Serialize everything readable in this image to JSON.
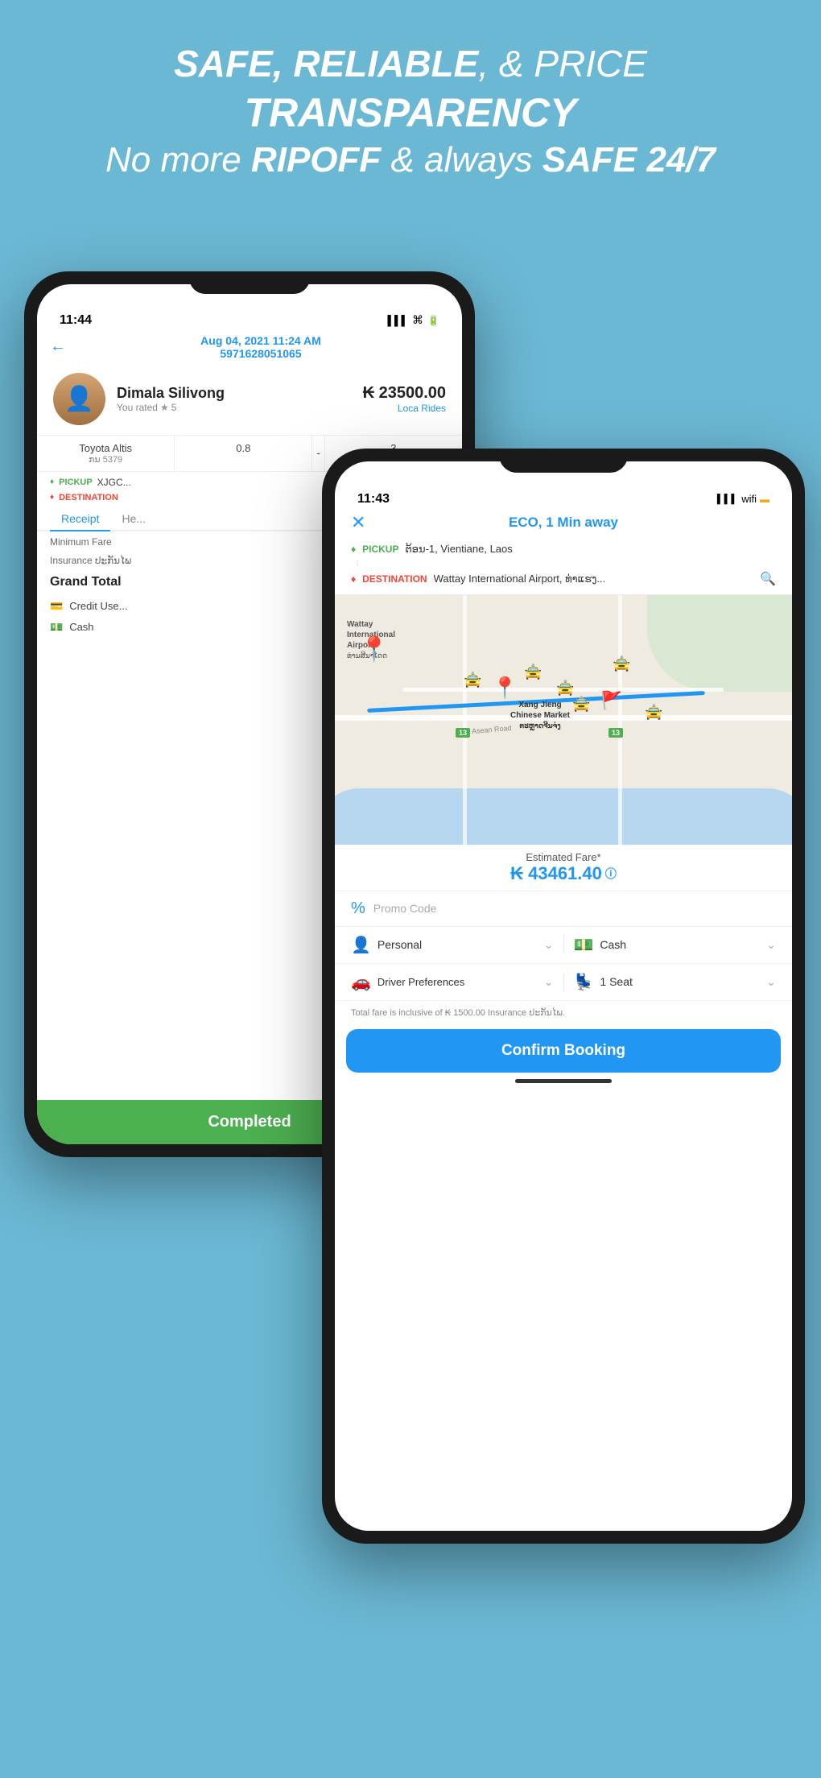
{
  "headline": {
    "line1_prefix": "SAFE, ",
    "line1_bold1": "RELIABLE",
    "line1_suffix": ", & PRICE",
    "line2_bold": "TRANSPARENCY",
    "line3_prefix": "No more ",
    "line3_bold1": "RIPOFF",
    "line3_suffix": " & always ",
    "line3_bold2": "SAFE 24/7"
  },
  "phone_back": {
    "status_time": "11:44",
    "header_date": "Aug 04, 2021 11:24 AM",
    "header_booking_id": "5971628051065",
    "driver_name": "Dimala  Silivong",
    "driver_rating_text": "You rated",
    "driver_rating_stars": "★",
    "driver_rating_value": "5",
    "fare_amount": "₭ 23500.00",
    "fare_service": "Loca Rides",
    "car_model": "Toyota Altis",
    "car_distance": "0.8",
    "car_separator": "-",
    "car_time": "3",
    "car_plate": "ກນ 5379",
    "pickup_label": "PICKUP",
    "pickup_text": "XJGC...",
    "dest_label": "DESTINATION",
    "tab_receipt": "Receipt",
    "tab_help": "He...",
    "min_fare_label": "Minimum Fare",
    "insurance_label": "Insurance ປະກັນໄພ",
    "grand_total_label": "Grand Total",
    "payment_credit": "Credit Use...",
    "payment_cash": "Cash",
    "completed_label": "Completed"
  },
  "phone_front": {
    "status_time": "11:43",
    "header_title": "ECO, 1 Min away",
    "close_btn": "✕",
    "pickup_label": "PICKUP",
    "pickup_addr": "ຕ້ອນ-1, Vientiane, Laos",
    "dest_label": "DESTINATION",
    "dest_addr": "Wattay International Airport, ທ່າແຮງ...",
    "map_airport_label": "Wattay\nInternational\nAirport",
    "map_market_label": "Xang Jieng\nChinese Market\nຕະຫຼາດຈີນຈ່ງ",
    "estimated_fare_label": "Estimated Fare*",
    "estimated_fare": "₭ 43461.40",
    "promo_placeholder": "Promo Code",
    "option1_label": "Personal",
    "option2_label": "Cash",
    "pref1_label": "Driver Preferences",
    "pref2_label": "1 Seat",
    "insurance_note": "Total fare is inclusive of ₭ 1500.00 Insurance ປະກັນໄພ.",
    "confirm_btn": "Confirm Booking"
  }
}
